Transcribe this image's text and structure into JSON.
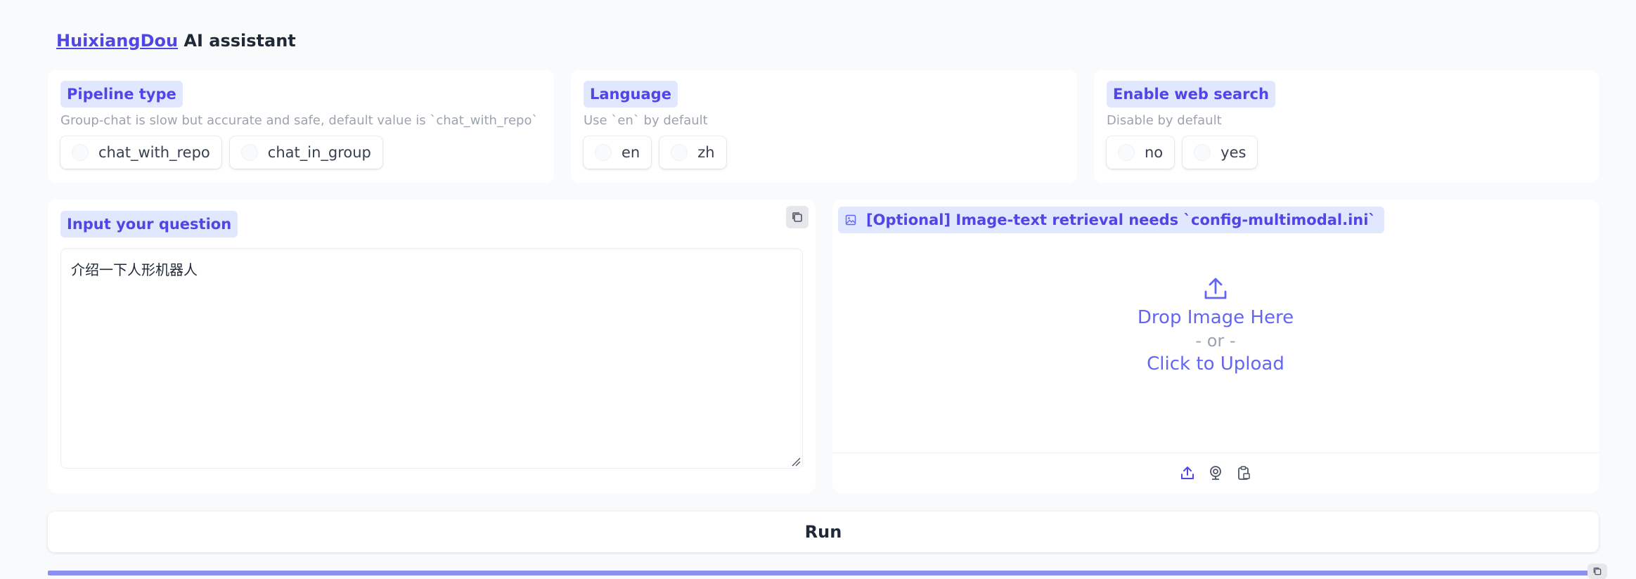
{
  "header": {
    "brand_link": "HuixiangDou",
    "title_rest": " AI assistant"
  },
  "pipeline": {
    "label": "Pipeline type",
    "hint": "Group-chat is slow but accurate and safe, default value is `chat_with_repo`",
    "options": [
      "chat_with_repo",
      "chat_in_group"
    ]
  },
  "language": {
    "label": "Language",
    "hint": "Use `en` by default",
    "options": [
      "en",
      "zh"
    ]
  },
  "web_search": {
    "label": "Enable web search",
    "hint": "Disable by default",
    "options": [
      "no",
      "yes"
    ]
  },
  "question": {
    "label": "Input your question",
    "value": "介绍一下人形机器人"
  },
  "image": {
    "label": "[Optional] Image-text retrieval needs `config-multimodal.ini`",
    "drop_text": "Drop Image Here",
    "or_text": "- or -",
    "click_text": "Click to Upload",
    "toolbar_icons": [
      "upload-icon",
      "webcam-icon",
      "clipboard-icon"
    ]
  },
  "run": {
    "label": "Run"
  },
  "colors": {
    "accent": "#6366f1",
    "chip_bg": "#e0e7ff",
    "page_bg": "#f9fafb"
  }
}
